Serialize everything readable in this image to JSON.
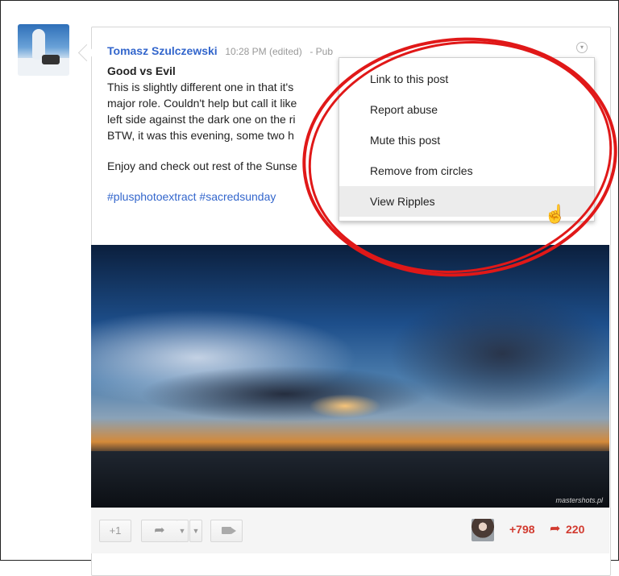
{
  "post": {
    "author": "Tomasz Szulczewski",
    "time": "10:28 PM (edited)",
    "visibility": "-  Pub",
    "title": "Good vs Evil",
    "lines": [
      "This is slightly different one in that it's",
      "major role. Couldn't help but call it like",
      "left side against the dark one on the ri",
      "BTW, it was this evening, some two h"
    ],
    "closing": "Enjoy and check out rest of the Sunse",
    "hashtags": "#plusphotoextract #sacredsunday",
    "watermark": "mastershots.pl"
  },
  "menu": {
    "items": [
      "Link to this post",
      "Report abuse",
      "Mute this post",
      "Remove from circles",
      "View Ripples"
    ],
    "hovered": "View Ripples"
  },
  "actions": {
    "plus_one": "+1",
    "plus_count": "+798",
    "share_count": "220"
  },
  "icons": {
    "menu_trigger": "chevron-down-circle-icon",
    "share": "share-arrow-icon",
    "hangout": "video-camera-icon",
    "cursor": "hand-pointer-icon"
  },
  "colors": {
    "author_link": "#3366cc",
    "highlight_circle": "#e01818",
    "counts": "#d23a2f"
  }
}
